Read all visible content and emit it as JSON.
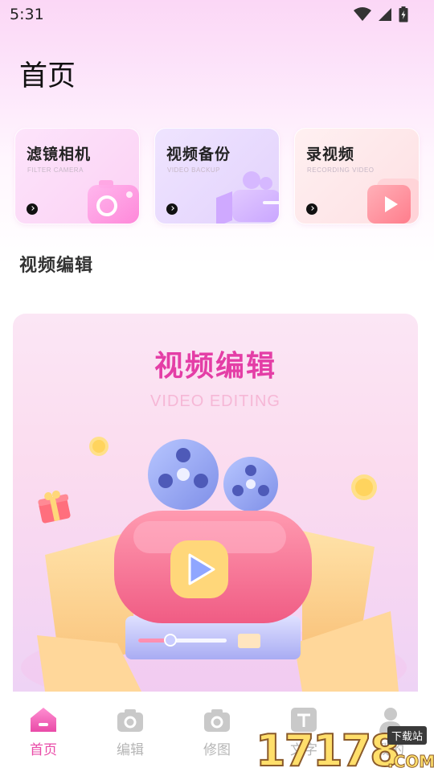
{
  "status_bar": {
    "time": "5:31",
    "icons": [
      "wifi-icon",
      "signal-icon",
      "battery-icon"
    ]
  },
  "header": {
    "title": "首页"
  },
  "cards": [
    {
      "title": "滤镜相机",
      "subtitle": "FILTER CAMERA",
      "icon": "camera-icon"
    },
    {
      "title": "视频备份",
      "subtitle": "VIDEO BACKUP",
      "icon": "video-camera-icon"
    },
    {
      "title": "录视频",
      "subtitle": "RECORDING VIDEO",
      "icon": "play-icon"
    }
  ],
  "section": {
    "title": "视频编辑"
  },
  "banner": {
    "title": "视频编辑",
    "subtitle": "VIDEO EDITING",
    "illustration": "film-projector-illustration"
  },
  "bottom_nav": {
    "items": [
      {
        "label": "首页",
        "icon": "home-icon",
        "active": true
      },
      {
        "label": "编辑",
        "icon": "camera-icon",
        "active": false
      },
      {
        "label": "修图",
        "icon": "camera-icon",
        "active": false
      },
      {
        "label": "文字",
        "icon": "text-icon",
        "active": false
      },
      {
        "label": "我的",
        "icon": "user-icon",
        "active": false
      }
    ]
  },
  "watermark": {
    "text": "17178",
    "domain": ".COM",
    "tag": "下载站"
  },
  "colors": {
    "accent": "#e94aa7",
    "banner_title": "#e43ea6",
    "inactive": "#b5b5b5"
  }
}
